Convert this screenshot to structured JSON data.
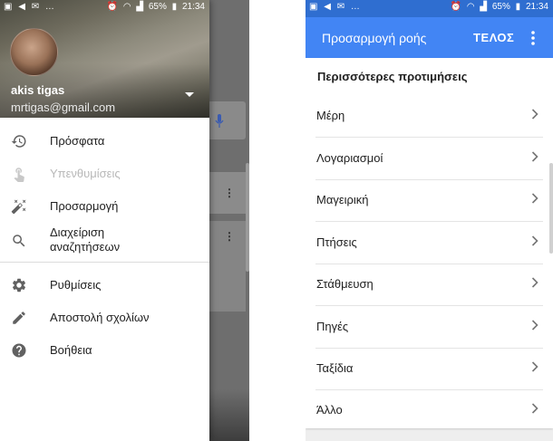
{
  "status_bar": {
    "battery": "65%",
    "time": "21:34"
  },
  "left": {
    "account": {
      "name": "akis tigas",
      "email": "mrtigas@gmail.com"
    },
    "menu": [
      {
        "label": "Πρόσφατα",
        "icon": "history-icon",
        "disabled": false
      },
      {
        "label": "Υπενθυμίσεις",
        "icon": "reminder-hand-icon",
        "disabled": true
      },
      {
        "label": "Προσαρμογή",
        "icon": "magic-wand-icon",
        "disabled": false
      },
      {
        "label": "Διαχείριση αναζητήσεων",
        "icon": "search-icon",
        "disabled": false
      },
      {
        "label": "Ρυθμίσεις",
        "icon": "gear-icon",
        "disabled": false
      },
      {
        "label": "Αποστολή σχολίων",
        "icon": "pencil-icon",
        "disabled": false
      },
      {
        "label": "Βοήθεια",
        "icon": "help-icon",
        "disabled": false
      }
    ]
  },
  "right": {
    "toolbar": {
      "title": "Προσαρμογή ροής",
      "action": "ΤΕΛΟΣ"
    },
    "section_title": "Περισσότερες προτιμήσεις",
    "items": [
      {
        "label": "Μέρη"
      },
      {
        "label": "Λογαριασμοί"
      },
      {
        "label": "Μαγειρική"
      },
      {
        "label": "Πτήσεις"
      },
      {
        "label": "Στάθμευση"
      },
      {
        "label": "Πηγές"
      },
      {
        "label": "Ταξίδια"
      },
      {
        "label": "Άλλο"
      }
    ]
  },
  "colors": {
    "toolbar_blue": "#4285f4",
    "status_blue": "#2f6ed0",
    "icon_grey": "#616161"
  }
}
